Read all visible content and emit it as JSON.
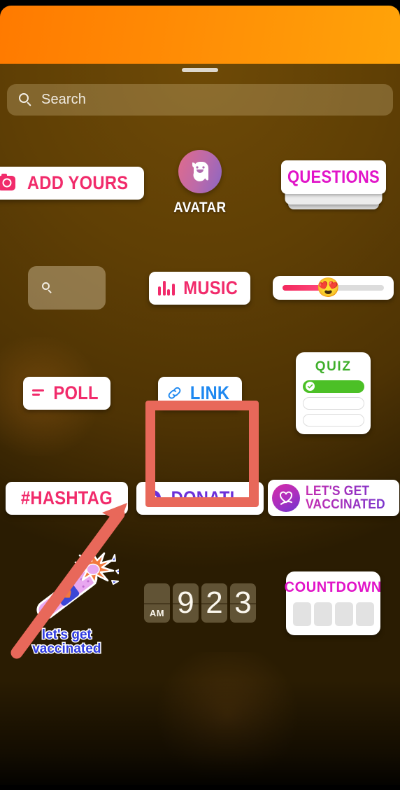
{
  "header": {
    "story_strip_color": "#FF8C05",
    "grabber": "drag-handle"
  },
  "search": {
    "placeholder": "Search",
    "value": "",
    "icon": "search-icon"
  },
  "stickers": {
    "add_yours": {
      "label": "ADD YOURS",
      "icon": "camera-icon",
      "color": "#F12B6B"
    },
    "avatar": {
      "label": "AVATAR",
      "icon": "avatar-icon"
    },
    "questions": {
      "label": "QUESTIONS",
      "color": "#E114C8"
    },
    "search_tile": {
      "label": "",
      "icon": "search-icon"
    },
    "music": {
      "label": "MUSIC",
      "icon": "equalizer-icon",
      "color": "#F12B6B"
    },
    "emoji_slider": {
      "emoji": "😍",
      "fill_percent": 45
    },
    "poll": {
      "label": "POLL",
      "icon": "poll-bars-icon",
      "color": "#F12B6B"
    },
    "link": {
      "label": "LINK",
      "icon": "chain-link-icon",
      "color": "#1E88F0"
    },
    "quiz": {
      "label": "QUIZ",
      "color": "#3FAF2B",
      "options": [
        "",
        "",
        ""
      ],
      "correct_index": 0
    },
    "hashtag": {
      "label": "#HASHTAG",
      "color": "#F12B6B"
    },
    "donation": {
      "label": "DONATI...",
      "icon": "heart-icon",
      "color": "#6C30D9"
    },
    "lets_get_vaccinated_badge": {
      "line1": "LET'S GET",
      "line2": "VACCINATED",
      "icon": "heart-ribbon-icon"
    },
    "bandaid": {
      "line1": "let's get",
      "line2": "vaccinated",
      "icon": "bandaid-flower-icon"
    },
    "clock": {
      "ampm": "AM",
      "digits": [
        "9",
        "2",
        "3"
      ]
    },
    "countdown": {
      "label": "COUNTDOWN",
      "color": "#E114C8",
      "blocks": 4
    }
  },
  "annotations": {
    "highlight_color": "#E8685A",
    "highlight_target": "link",
    "arrow_color": "#E8685A"
  }
}
